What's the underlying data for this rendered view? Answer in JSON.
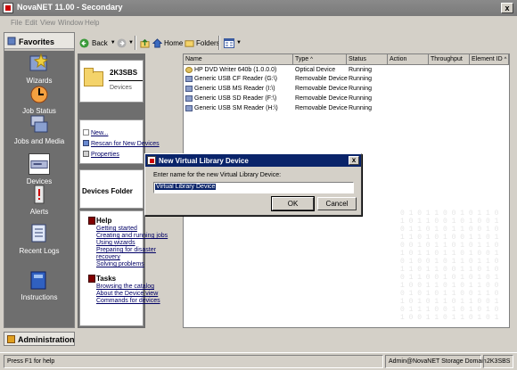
{
  "window": {
    "title": "NovaNET 11.00 - Secondary",
    "close_label": "x"
  },
  "menu": [
    "File",
    "Edit",
    "View",
    "Window",
    "Help"
  ],
  "nav": {
    "favorites_label": "Favorites",
    "items": [
      {
        "label": "Wizards",
        "icon": "wand-icon"
      },
      {
        "label": "Job Status",
        "icon": "job-status-icon"
      },
      {
        "label": "Jobs and Media",
        "icon": "jobs-media-icon"
      },
      {
        "label": "Devices",
        "icon": "devices-icon",
        "selected": true
      },
      {
        "label": "Alerts",
        "icon": "alert-icon"
      },
      {
        "label": "Recent Logs",
        "icon": "logs-icon"
      },
      {
        "label": "Instructions",
        "icon": "instructions-icon"
      }
    ],
    "admin_label": "Administration"
  },
  "toolbar": {
    "back": "Back",
    "home": "Home",
    "folders": "Folders"
  },
  "tasks": {
    "server": "2K3SBS",
    "section": "Devices",
    "actions": [
      "New...",
      "Rescan for New Devices",
      "Properties"
    ],
    "folder_header": "Devices Folder",
    "help_title": "Help",
    "help_links": [
      "Getting started",
      "Creating and running jobs",
      "Using wizards",
      "Preparing for disaster",
      "recovery",
      "Solving problems"
    ],
    "tasks_title": "Tasks",
    "task_links": [
      "Browsing the catalog",
      "About the Device view",
      "Commands for devices"
    ]
  },
  "list": {
    "columns": [
      "Name",
      "Type",
      "Status",
      "Action",
      "Throughput",
      "Element ID"
    ],
    "rows": [
      {
        "name": "HP DVD Writer 640b (1.0.0.0)",
        "type": "Optical Device",
        "status": "Running",
        "icon": "dvd"
      },
      {
        "name": "Generic USB CF Reader (G:\\)",
        "type": "Removable Device",
        "status": "Running",
        "icon": "usb"
      },
      {
        "name": "Generic USB MS Reader (I:\\)",
        "type": "Removable Device",
        "status": "Running",
        "icon": "usb"
      },
      {
        "name": "Generic USB SD Reader (F:\\)",
        "type": "Removable Device",
        "status": "Running",
        "icon": "usb"
      },
      {
        "name": "Generic USB SM Reader (H:\\)",
        "type": "Removable Device",
        "status": "Running",
        "icon": "usb"
      }
    ]
  },
  "dialog": {
    "title": "New Virtual Library Device",
    "prompt": "Enter name for the new Virtual Library Device:",
    "value": "Virtual Library Device",
    "ok": "OK",
    "cancel": "Cancel"
  },
  "status": {
    "help": "Press F1 for help",
    "user": "Admin@NovaNET Storage Domain",
    "server": "2K3SBS"
  }
}
